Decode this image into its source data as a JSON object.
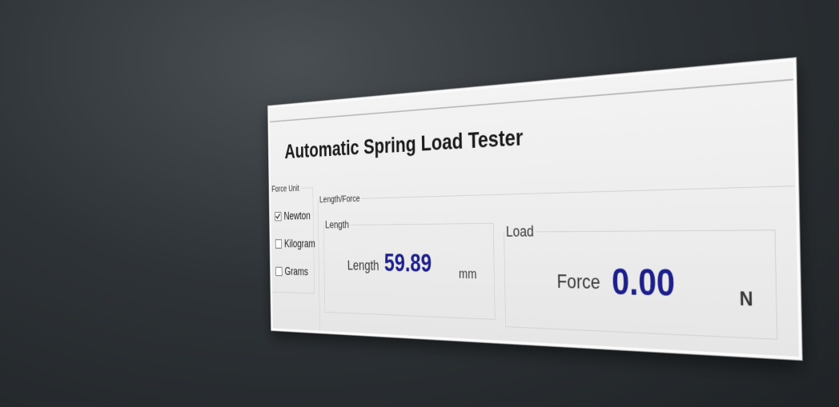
{
  "window": {
    "title": "Automatic Spring Load Tester"
  },
  "force_unit": {
    "legend": "Force Unit",
    "options": [
      {
        "label": "Newton",
        "checked": true
      },
      {
        "label": "Kilogram",
        "checked": false
      },
      {
        "label": "Grams",
        "checked": false
      }
    ]
  },
  "length_force": {
    "legend": "Length/Force",
    "length": {
      "legend": "Length",
      "label": "Length",
      "value": "59.89",
      "unit": "mm"
    },
    "load": {
      "legend": "Load",
      "label": "Force",
      "value": "0.00",
      "unit": "N"
    }
  },
  "colors": {
    "value_text": "#1d1f8a",
    "panel_bg": "#ececec",
    "backdrop": "#2e3337"
  }
}
